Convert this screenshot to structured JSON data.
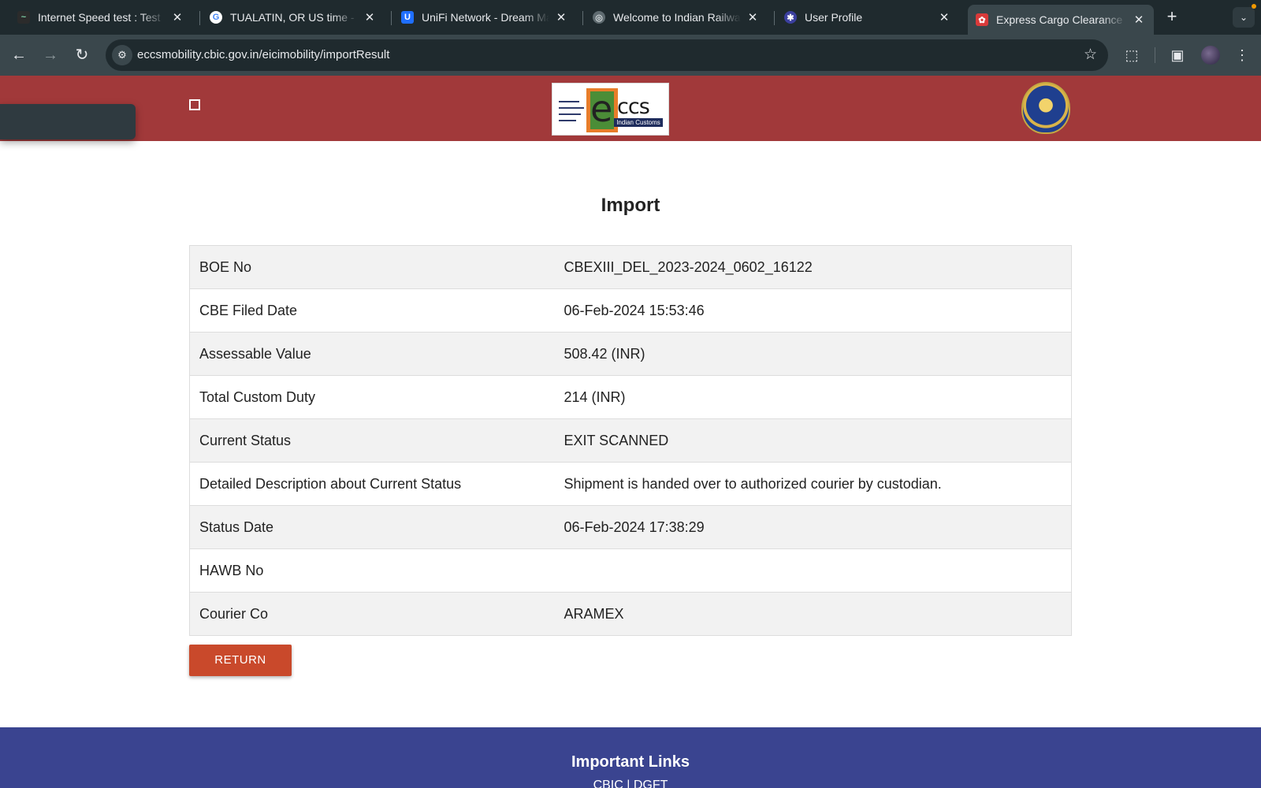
{
  "browser": {
    "tabs": [
      {
        "title": "Internet Speed test : Test",
        "icon": "speedtest-icon",
        "color": "#2b2b2b"
      },
      {
        "title": "TUALATIN, OR US time - G",
        "icon": "google-icon",
        "color": "#ffffff"
      },
      {
        "title": "UniFi Network - Dream Ma",
        "icon": "unifi-icon",
        "color": "#1f6fff"
      },
      {
        "title": "Welcome to Indian Railway",
        "icon": "globe-icon",
        "color": "#5f6b70"
      },
      {
        "title": "User Profile",
        "icon": "profile-icon",
        "color": "#3b3f9e"
      },
      {
        "title": "Express Cargo Clearance",
        "icon": "cbic-icon",
        "color": "#d93a3a"
      }
    ],
    "new_tab": "+",
    "tab_menu": "⌄",
    "url": "eccsmobility.cbic.gov.in/eicimobility/importResult"
  },
  "header": {
    "logo_text": "ccs",
    "logo_subtext": "Indian Customs"
  },
  "main": {
    "title": "Import",
    "rows": [
      {
        "label": "BOE No",
        "value": "CBEXIII_DEL_2023-2024_0602_16122"
      },
      {
        "label": "CBE Filed Date",
        "value": "06-Feb-2024 15:53:46"
      },
      {
        "label": "Assessable Value",
        "value": "508.42 (INR)"
      },
      {
        "label": "Total Custom Duty",
        "value": "214 (INR)"
      },
      {
        "label": "Current Status",
        "value": "EXIT SCANNED"
      },
      {
        "label": "Detailed Description about Current Status",
        "value": "Shipment is handed over to authorized courier by custodian."
      },
      {
        "label": "Status Date",
        "value": "06-Feb-2024 17:38:29"
      },
      {
        "label": "HAWB No",
        "value": ""
      },
      {
        "label": "Courier Co",
        "value": "ARAMEX"
      }
    ],
    "return_label": "RETURN"
  },
  "footer": {
    "title": "Important Links",
    "links": "CBIC | DGFT"
  },
  "colors": {
    "header_bg": "#a1393a",
    "button_bg": "#c9492b",
    "footer_bg": "#3a4490"
  }
}
